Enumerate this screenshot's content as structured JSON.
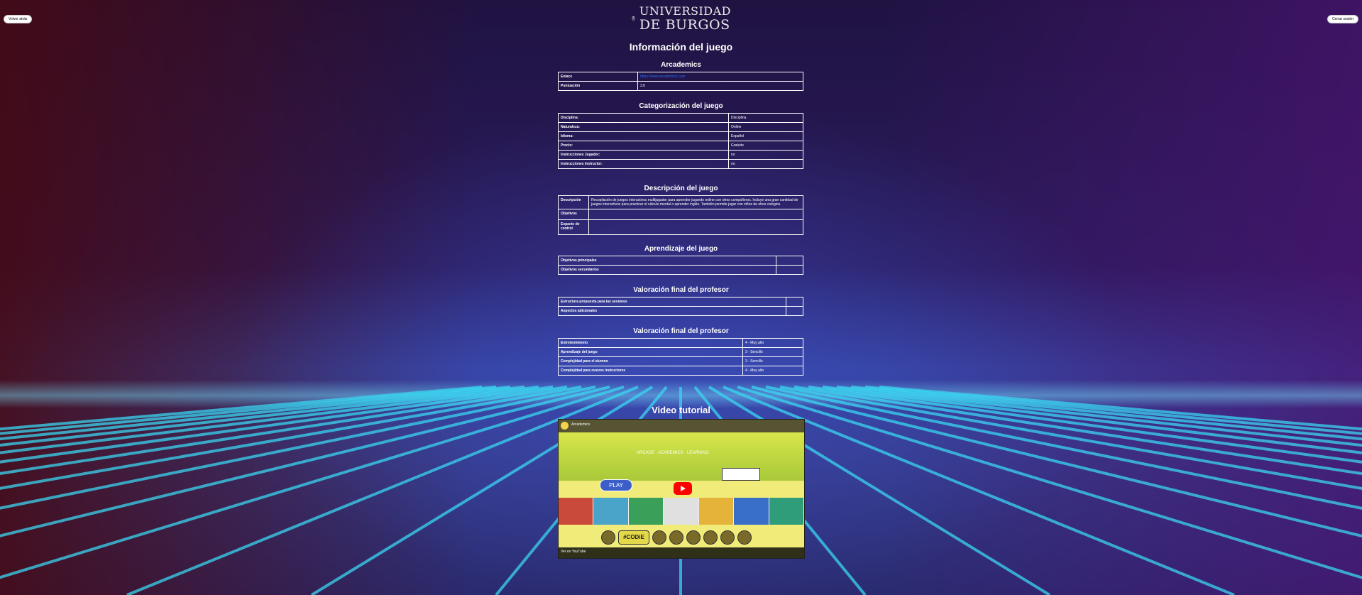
{
  "header": {
    "left_button": "Volver atrás",
    "right_button": "Cerrar sesión",
    "logo_line1": "UNIVERSIDAD",
    "logo_line2": "DE BURGOS"
  },
  "page_title": "Información del juego",
  "game_name": "Arcademics",
  "info_table": [
    {
      "key": "Enlace",
      "value": "https://www.arcademics.com"
    },
    {
      "key": "Puntuación",
      "value": "3.0"
    }
  ],
  "categorization": {
    "title": "Categorización del juego",
    "rows": [
      {
        "key": "Disciplina:",
        "value": "Disciplina"
      },
      {
        "key": "Naturaleza:",
        "value": "Online"
      },
      {
        "key": "Idioma:",
        "value": "Español"
      },
      {
        "key": "Precio:",
        "value": "Gratuito"
      },
      {
        "key": "Instrucciones Jugador:",
        "value": "no"
      },
      {
        "key": "Instrucciones Instructor:",
        "value": "no"
      }
    ]
  },
  "description": {
    "title": "Descripción del juego",
    "rows": [
      {
        "key": "Descripción",
        "value": "Recopilación de juegos interactivos multijugador para aprender jugando online con otros compañeros. Incluye una gran cantidad de juegos interactivos para practicar el cálculo mental o aprender inglés. También permite jugar con niños de otros colegios."
      },
      {
        "key": "Objetivos",
        "value": ""
      },
      {
        "key": "Espacio de control",
        "value": ""
      }
    ]
  },
  "learning": {
    "title": "Aprendizaje del juego",
    "rows": [
      {
        "key": "Objetivos principales",
        "value": ""
      },
      {
        "key": "Objetivos secundarios",
        "value": ""
      }
    ]
  },
  "teacher_eval_1": {
    "title": "Valoración final del profesor",
    "rows": [
      {
        "key": "Estructura propuesta para las sesiones",
        "value": ""
      },
      {
        "key": "Aspectos adicionales",
        "value": ""
      }
    ]
  },
  "teacher_eval_2": {
    "title": "Valoración final del profesor",
    "rows": [
      {
        "key": "Entretenimiento",
        "value": "4 - Muy alto"
      },
      {
        "key": "Aprendizaje del juego",
        "value": "3 - Sencillo"
      },
      {
        "key": "Complejidad para el alumno",
        "value": "3 - Sencillo"
      },
      {
        "key": "Complejidad para nuevos instructores",
        "value": "4 - Muy alto"
      }
    ]
  },
  "video": {
    "title": "Video tutorial",
    "channel_title": "Arcademics",
    "play_label": "PLAY",
    "badge_text": "#CODiE",
    "watch_on": "Ver en YouTube",
    "colors": {
      "youtube_red": "#ff0000",
      "background": "#f1ec7a"
    }
  }
}
